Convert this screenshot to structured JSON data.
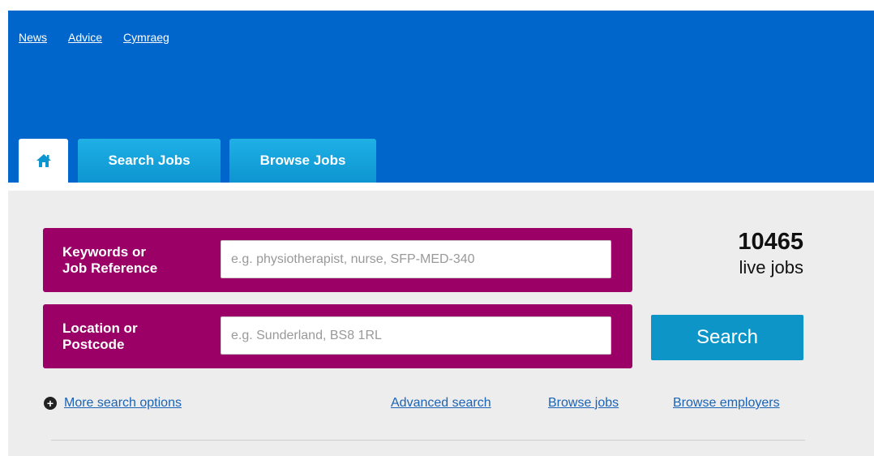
{
  "header": {
    "top_links": [
      "News",
      "Advice",
      "Cymraeg"
    ],
    "tabs": {
      "home_icon": "home-icon",
      "search_jobs": "Search Jobs",
      "browse_jobs": "Browse Jobs"
    },
    "colors": {
      "header_bg": "#0066cc",
      "tab_bg": "#1fb0e6"
    }
  },
  "search": {
    "keywords": {
      "label": "Keywords or\nJob Reference",
      "placeholder": "e.g. physiotherapist, nurse, SFP-MED-340"
    },
    "location": {
      "label": "Location or\nPostcode",
      "placeholder": "e.g. Sunderland, BS8 1RL"
    },
    "button": "Search",
    "colors": {
      "field_bg": "#9a0066",
      "button_bg": "#0d95c8"
    }
  },
  "stats": {
    "count": "10465",
    "label": "live jobs"
  },
  "links": {
    "more_icon": "plus-circle-icon",
    "more_search": "More search options",
    "advanced": "Advanced search",
    "browse_jobs": "Browse jobs",
    "browse_employers": "Browse employers"
  }
}
